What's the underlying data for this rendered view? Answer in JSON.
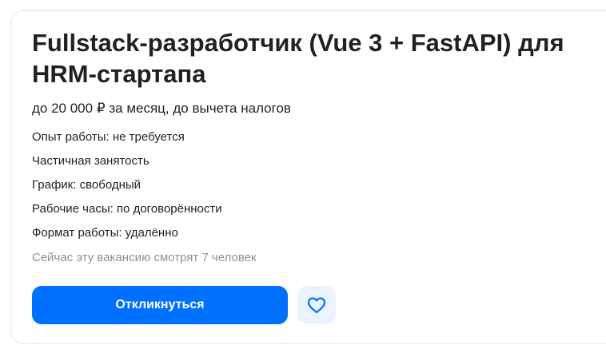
{
  "vacancy": {
    "title": "Fullstack-разработчик (Vue 3 + FastAPI) для HRM-стартапа",
    "salary": "до 20 000 ₽ за месяц, до вычета налогов",
    "experience": "Опыт работы: не требуется",
    "employment": "Частичная занятость",
    "schedule": "График: свободный",
    "working_hours": "Рабочие часы: по договорённости",
    "work_format": "Формат работы: удалённо",
    "viewers": "Сейчас эту вакансию смотрят 7 человек"
  },
  "actions": {
    "respond_label": "Откликнуться",
    "favorite_icon": "heart-icon"
  },
  "colors": {
    "accent": "#0070ff",
    "favorite_bg": "#ebf3ff",
    "muted_text": "#8a9299"
  }
}
